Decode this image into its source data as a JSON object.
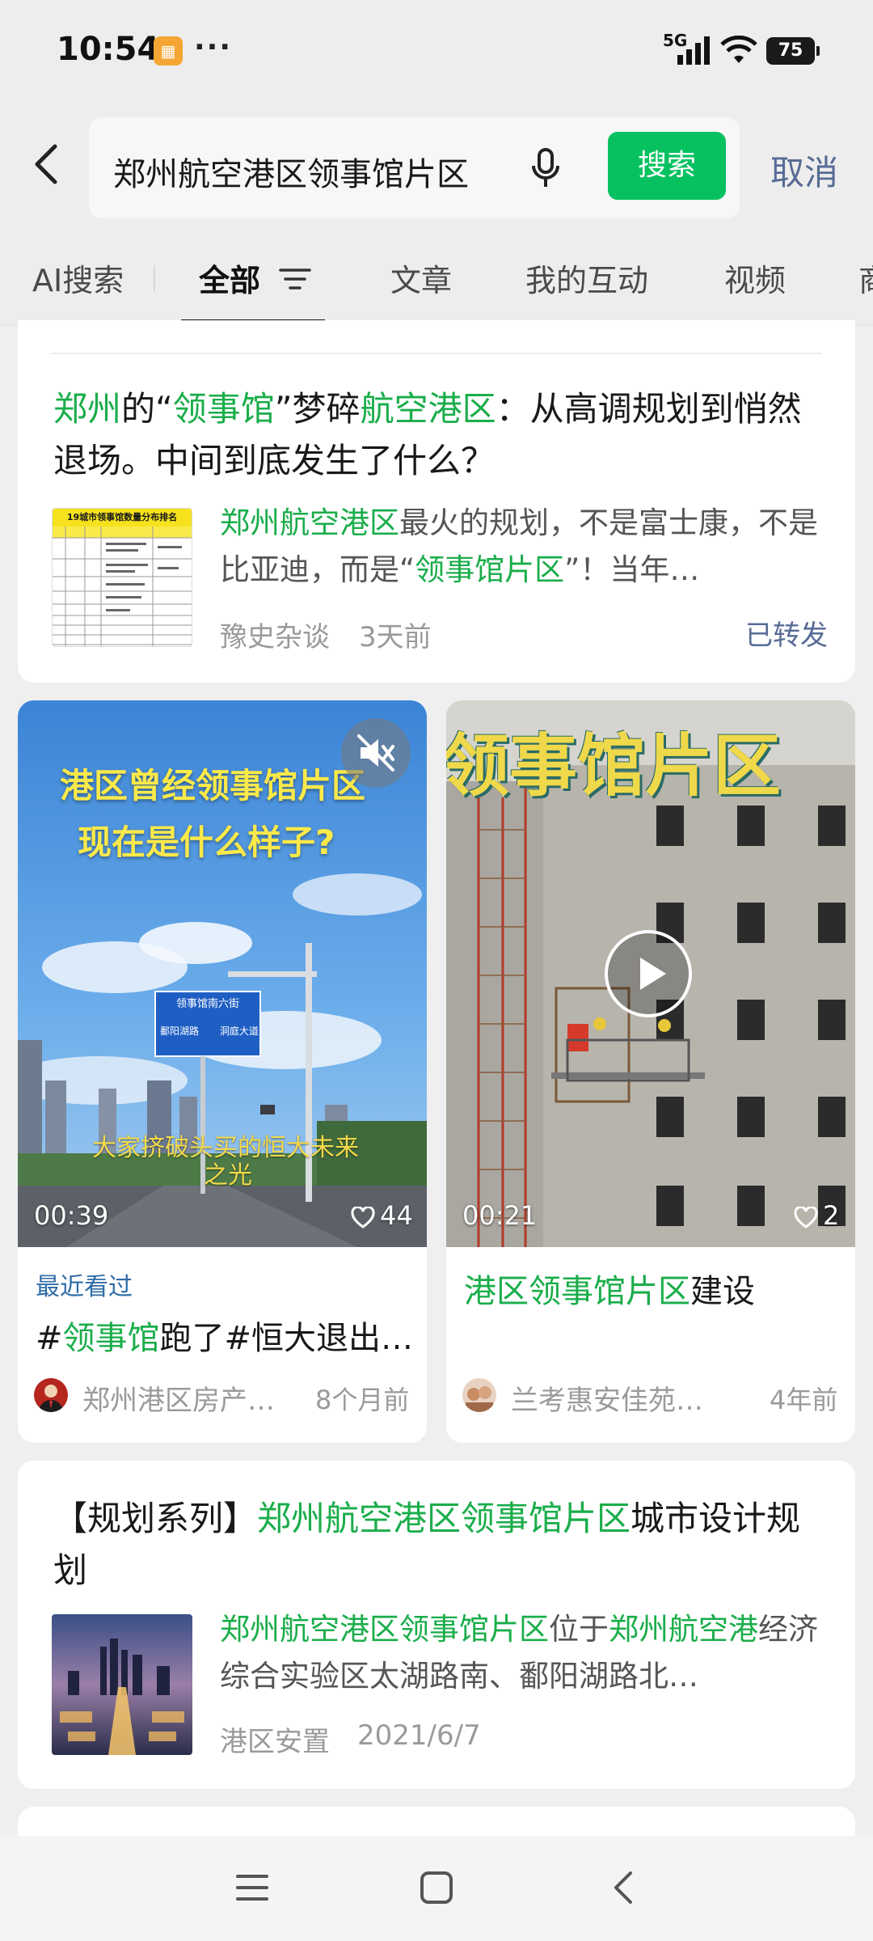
{
  "status_bar": {
    "time": "10:54",
    "network": "5G",
    "battery": "75"
  },
  "search": {
    "query": "郑州航空港区领事馆片区",
    "button_label": "搜索",
    "cancel_label": "取消"
  },
  "tabs": [
    {
      "label": "AI搜索"
    },
    {
      "label": "全部"
    },
    {
      "label": "文章"
    },
    {
      "label": "我的互动"
    },
    {
      "label": "视频"
    },
    {
      "label": "商"
    }
  ],
  "article1": {
    "title_parts": [
      "郑州",
      "的“",
      "领事馆",
      "”梦碎",
      "航空港区",
      "：从高调规划到悄然退场。中间到底发生了什么？"
    ],
    "thumb_title": "19城市领事馆数量分布排名",
    "snippet_parts": [
      "郑州航空港区",
      "最火的规划，不是富士康，不是比亚迪，而是“",
      "领事馆片区",
      "”！当年…"
    ],
    "source": "豫史杂谈",
    "time": "3天前",
    "forwarded": "已转发"
  },
  "video1": {
    "overlay_line1": "港区曾经领事馆片区",
    "overlay_line2": "现在是什么样子?",
    "sign_top": "领事馆南六街",
    "sign_left": "鄱阳湖路",
    "sign_right": "洞庭大道",
    "subtitle_line1": "大家挤破头买的恒大未来",
    "subtitle_line2": "之光",
    "duration": "00:39",
    "likes": "44",
    "recent_tag": "最近看过",
    "title_parts": [
      "#",
      "领事馆",
      "跑了#恒大退出…"
    ],
    "author": "郑州港区房产…",
    "ago": "8个月前"
  },
  "video2": {
    "banner": "领事馆片区",
    "duration": "00:21",
    "likes": "2",
    "title_parts": [
      "港区领事馆片区",
      "建设"
    ],
    "author": "兰考惠安佳苑…",
    "ago": "4年前"
  },
  "article2": {
    "title_parts": [
      "【规划系列】",
      "郑州航空港区领事馆片区",
      "城市设计规划"
    ],
    "snippet_parts": [
      "郑州航空港区领事馆片区",
      "位于",
      "郑州航空港",
      "经济综合实验区太湖路南、鄱阳湖路北…"
    ],
    "source": "港区安置",
    "time": "2021/6/7"
  },
  "colors": {
    "highlight": "#1aad4a",
    "search_button": "#07c160",
    "link_blue": "#576b95"
  }
}
